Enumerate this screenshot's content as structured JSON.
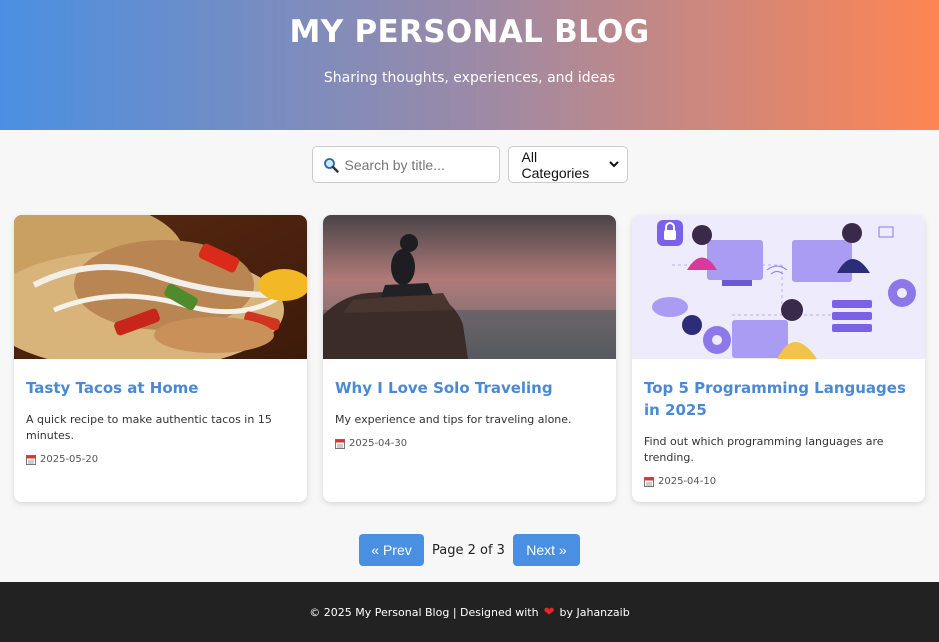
{
  "header": {
    "title": "MY PERSONAL BLOG",
    "subtitle": "Sharing thoughts, experiences, and ideas"
  },
  "search": {
    "placeholder": "Search by title...",
    "icon": "search-icon"
  },
  "category_filter": {
    "selected": "All Categories"
  },
  "posts": [
    {
      "title": "Tasty Tacos at Home",
      "excerpt": "A quick recipe to make authentic tacos in 15 minutes.",
      "date": "2025-05-20",
      "image": "tacos-photo"
    },
    {
      "title": "Why I Love Solo Traveling",
      "excerpt": "My experience and tips for traveling alone.",
      "date": "2025-04-30",
      "image": "traveler-on-rock-photo"
    },
    {
      "title": "Top 5 Programming Languages in 2025",
      "excerpt": "Find out which programming languages are trending.",
      "date": "2025-04-10",
      "image": "programmers-illustration"
    }
  ],
  "pagination": {
    "prev_label": "« Prev",
    "info": "Page 2 of 3",
    "next_label": "Next »"
  },
  "footer": {
    "text_before": "© 2025 My Personal Blog | Designed with",
    "text_after": "by Jahanzaib",
    "heart": "❤"
  },
  "colors": {
    "accent": "#4a90e2",
    "title_blue": "#4a8ad4",
    "gradient_start": "#4a90e2",
    "gradient_end": "#ff8552",
    "footer_bg": "#222222"
  }
}
